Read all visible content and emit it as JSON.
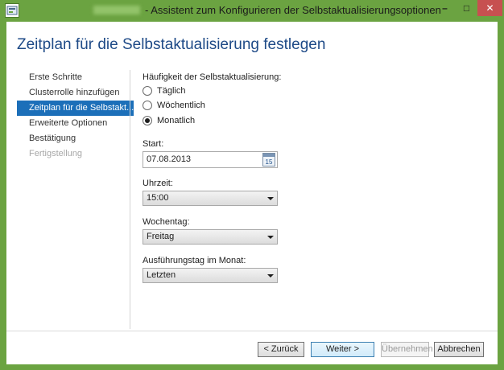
{
  "window": {
    "title": "- Assistent zum Konfigurieren der Selbstaktualisierungsoptionen",
    "minimize_glyph": "–",
    "maximize_glyph": "□",
    "close_glyph": "✕"
  },
  "page": {
    "heading": "Zeitplan für die Selbstaktualisierung festlegen"
  },
  "nav": {
    "items": [
      {
        "label": "Erste Schritte",
        "state": "normal"
      },
      {
        "label": "Clusterrolle hinzufügen",
        "state": "normal"
      },
      {
        "label": "Zeitplan für die Selbstakt...",
        "state": "active"
      },
      {
        "label": "Erweiterte Optionen",
        "state": "normal"
      },
      {
        "label": "Bestätigung",
        "state": "normal"
      },
      {
        "label": "Fertigstellung",
        "state": "disabled"
      }
    ]
  },
  "form": {
    "frequency_label": "Häufigkeit der Selbstaktualisierung:",
    "frequency_options": [
      {
        "label": "Täglich",
        "checked": false
      },
      {
        "label": "Wöchentlich",
        "checked": false
      },
      {
        "label": "Monatlich",
        "checked": true
      }
    ],
    "start_label": "Start:",
    "start_value": "07.08.2013",
    "calendar_icon_text": "15",
    "time_label": "Uhrzeit:",
    "time_value": "15:00",
    "weekday_label": "Wochentag:",
    "weekday_value": "Freitag",
    "monthday_label": "Ausführungstag im Monat:",
    "monthday_value": "Letzten"
  },
  "buttons": {
    "back": "< Zurück",
    "next": "Weiter >",
    "apply": "Übernehmen",
    "cancel": "Abbrechen"
  },
  "colors": {
    "accent_titlebar": "#6ba341",
    "heading": "#1e4a87",
    "nav_active": "#1c6fb9",
    "close_button": "#c75050"
  }
}
